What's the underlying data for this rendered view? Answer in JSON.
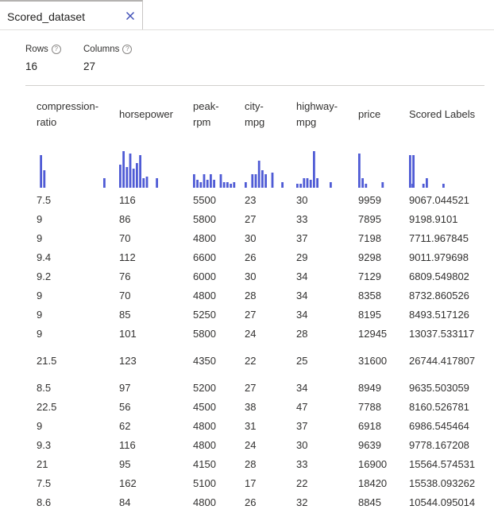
{
  "tab": {
    "title": "Scored_dataset"
  },
  "stats": {
    "rows_label": "Rows",
    "rows_value": "16",
    "columns_label": "Columns",
    "columns_value": "27"
  },
  "colors": {
    "histogram": "#4f5bd5"
  },
  "columns": [
    {
      "header": "compression-\nratio",
      "hist": [
        0,
        0.85,
        0.45,
        0,
        0,
        0,
        0,
        0,
        0,
        0,
        0,
        0,
        0,
        0,
        0,
        0,
        0,
        0,
        0,
        0,
        0.25
      ]
    },
    {
      "header": "horsepower",
      "hist": [
        0.6,
        0.95,
        0.55,
        0.9,
        0.5,
        0.65,
        0.85,
        0.25,
        0.3,
        0,
        0,
        0.25
      ]
    },
    {
      "header": "peak-\nrpm",
      "hist": [
        0.35,
        0.2,
        0.15,
        0.35,
        0.2,
        0.35,
        0.2,
        0,
        0.35,
        0.15,
        0.15,
        0.1,
        0.15
      ]
    },
    {
      "header": "city-\nmpg",
      "hist": [
        0.15,
        0,
        0.35,
        0.35,
        0.7,
        0.45,
        0.35,
        0,
        0.4,
        0,
        0,
        0.15
      ]
    },
    {
      "header": "highway-\nmpg",
      "hist": [
        0.1,
        0.1,
        0.25,
        0.25,
        0.2,
        0.95,
        0.25,
        0,
        0,
        0,
        0.15
      ]
    },
    {
      "header": "price",
      "hist": [
        0.9,
        0.25,
        0.1,
        0,
        0,
        0,
        0,
        0.15,
        0,
        0,
        0,
        0,
        0,
        0,
        0,
        0,
        0.1
      ]
    },
    {
      "header": "Scored Labels",
      "hist": [
        0.85,
        0.85,
        0,
        0,
        0.1,
        0.25,
        0,
        0,
        0,
        0,
        0.1
      ]
    }
  ],
  "rows": [
    [
      "7.5",
      "116",
      "5500",
      "23",
      "30",
      "9959",
      "9067.044521"
    ],
    [
      "9",
      "86",
      "5800",
      "27",
      "33",
      "7895",
      "9198.9101"
    ],
    [
      "9",
      "70",
      "4800",
      "30",
      "37",
      "7198",
      "7711.967845"
    ],
    [
      "9.4",
      "112",
      "6600",
      "26",
      "29",
      "9298",
      "9011.979698"
    ],
    [
      "9.2",
      "76",
      "6000",
      "30",
      "34",
      "7129",
      "6809.549802"
    ],
    [
      "9",
      "70",
      "4800",
      "28",
      "34",
      "8358",
      "8732.860526"
    ],
    [
      "9",
      "85",
      "5250",
      "27",
      "34",
      "8195",
      "8493.517126"
    ],
    [
      "9",
      "101",
      "5800",
      "24",
      "28",
      "12945",
      "13037.533117"
    ],
    [
      "21.5",
      "123",
      "4350",
      "22",
      "25",
      "31600",
      "26744.417807"
    ],
    [
      "8.5",
      "97",
      "5200",
      "27",
      "34",
      "8949",
      "9635.503059"
    ],
    [
      "22.5",
      "56",
      "4500",
      "38",
      "47",
      "7788",
      "8160.526781"
    ],
    [
      "9",
      "62",
      "4800",
      "31",
      "37",
      "6918",
      "6986.545464"
    ],
    [
      "9.3",
      "116",
      "4800",
      "24",
      "30",
      "9639",
      "9778.167208"
    ],
    [
      "21",
      "95",
      "4150",
      "28",
      "33",
      "16900",
      "15564.574531"
    ],
    [
      "7.5",
      "162",
      "5100",
      "17",
      "22",
      "18420",
      "15538.093262"
    ],
    [
      "8.6",
      "84",
      "4800",
      "26",
      "32",
      "8845",
      "10544.095014"
    ]
  ]
}
